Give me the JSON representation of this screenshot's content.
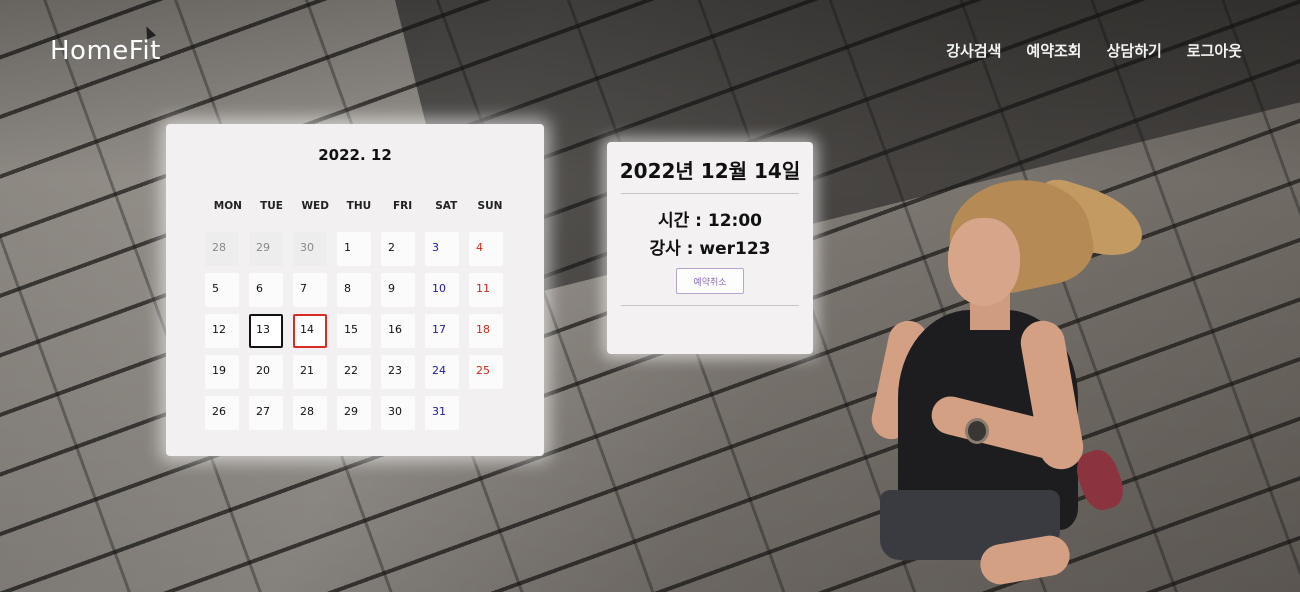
{
  "header": {
    "logo": "HomeFit",
    "nav": [
      {
        "label": "강사검색"
      },
      {
        "label": "예약조회"
      },
      {
        "label": "상담하기"
      },
      {
        "label": "로그아웃"
      }
    ]
  },
  "calendar": {
    "title": "2022. 12",
    "weekdays": [
      "MON",
      "TUE",
      "WED",
      "THU",
      "FRI",
      "SAT",
      "SUN"
    ],
    "days": [
      [
        "28",
        "29",
        "30",
        "1",
        "2",
        "3",
        "4"
      ],
      [
        "5",
        "6",
        "7",
        "8",
        "9",
        "10",
        "11"
      ],
      [
        "12",
        "13",
        "14",
        "15",
        "16",
        "17",
        "18"
      ],
      [
        "19",
        "20",
        "21",
        "22",
        "23",
        "24",
        "25"
      ],
      [
        "26",
        "27",
        "28",
        "29",
        "30",
        "31",
        ""
      ]
    ],
    "today": "13",
    "selected": "14"
  },
  "detail": {
    "date": "2022년 12월 14일",
    "time": "시간 : 12:00",
    "trainer": "강사 : wer123",
    "cancel_label": "예약취소"
  },
  "colors": {
    "saturday": "#1a1aa0",
    "sunday": "#d0261b",
    "selected_border": "#d92a24",
    "cancel_accent": "#8a6bb8"
  }
}
